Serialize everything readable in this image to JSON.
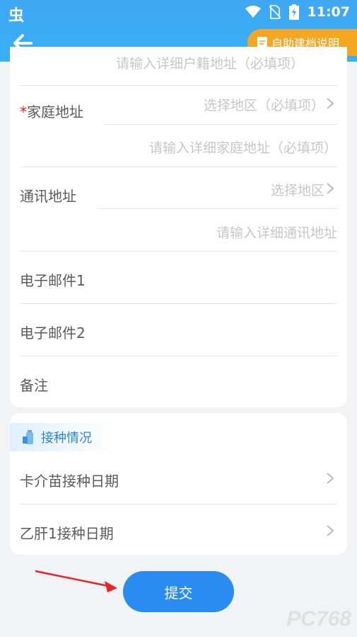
{
  "status_bar": {
    "app_icon_text": "虫",
    "time": "11:07"
  },
  "header": {
    "guide_button_label": "自助建档说明"
  },
  "form": {
    "native_address_partial_placeholder": "请输入详细户籍地址（必填项）",
    "home_address": {
      "required_mark": "*",
      "label": "家庭地址",
      "region_placeholder": "选择地区（必填项）",
      "detail_placeholder": "请输入详细家庭地址（必填项）"
    },
    "mail_address": {
      "label": "通讯地址",
      "region_placeholder": "选择地区",
      "detail_placeholder": "请输入详细通讯地址"
    },
    "email1_label": "电子邮件1",
    "email2_label": "电子邮件2",
    "remark_label": "备注"
  },
  "vaccination": {
    "section_title": "接种情况",
    "bcg_label": "卡介苗接种日期",
    "hepb1_label": "乙肝1接种日期"
  },
  "submit_label": "提交",
  "watermark": "PC768"
}
